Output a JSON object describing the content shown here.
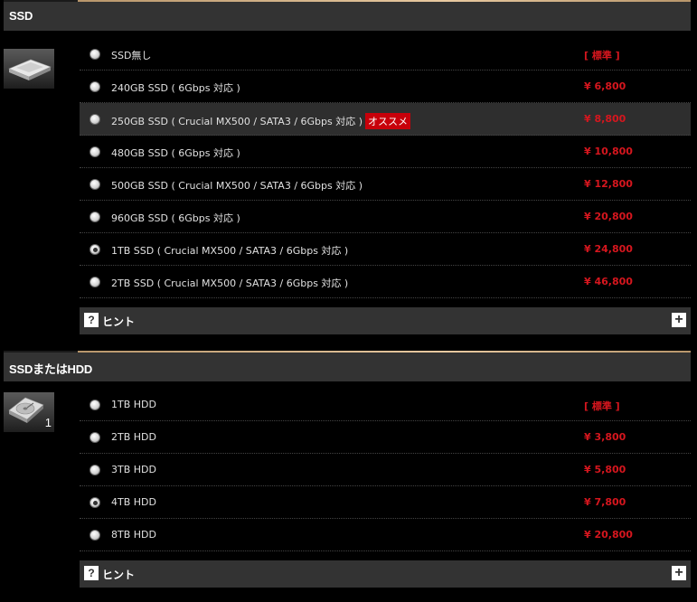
{
  "sections": [
    {
      "title": "SSD",
      "icon": "ssd-icon",
      "options": [
        {
          "label": "SSD無し",
          "price": "[ 標準 ]",
          "selected": false
        },
        {
          "label": "240GB SSD ( 6Gbps 対応 )",
          "price": "¥ 6,800",
          "selected": false
        },
        {
          "label": "250GB SSD ( Crucial MX500 / SATA3 / 6Gbps 対応 )",
          "badge": "オススメ",
          "price": "¥ 8,800",
          "selected": false
        },
        {
          "label": "480GB SSD ( 6Gbps 対応 )",
          "price": "¥ 10,800",
          "selected": false
        },
        {
          "label": "500GB SSD ( Crucial MX500 / SATA3 / 6Gbps 対応 )",
          "price": "¥ 12,800",
          "selected": false
        },
        {
          "label": "960GB SSD ( 6Gbps 対応 )",
          "price": "¥ 20,800",
          "selected": false
        },
        {
          "label": "1TB SSD ( Crucial MX500 / SATA3 / 6Gbps 対応 )",
          "price": "¥ 24,800",
          "selected": true
        },
        {
          "label": "2TB SSD ( Crucial MX500 / SATA3 / 6Gbps 対応 )",
          "price": "¥ 46,800",
          "selected": false
        }
      ],
      "hint": {
        "q": "?",
        "label": "ヒント",
        "expand": "+"
      }
    },
    {
      "title": "SSDまたはHDD",
      "icon": "hdd-icon",
      "icon_number": "1",
      "options": [
        {
          "label": "1TB HDD",
          "price": "[ 標準 ]",
          "selected": false
        },
        {
          "label": "2TB HDD",
          "price": "¥ 3,800",
          "selected": false
        },
        {
          "label": "3TB HDD",
          "price": "¥ 5,800",
          "selected": false
        },
        {
          "label": "4TB HDD",
          "price": "¥ 7,800",
          "selected": true
        },
        {
          "label": "8TB HDD",
          "price": "¥ 20,800",
          "selected": false
        }
      ],
      "hint": {
        "q": "?",
        "label": "ヒント",
        "expand": "+"
      }
    }
  ],
  "colors": {
    "price": "#d6161e",
    "badge": "#c8000a",
    "header_bg": "#333333",
    "accent_line": "#e8c9a0"
  }
}
